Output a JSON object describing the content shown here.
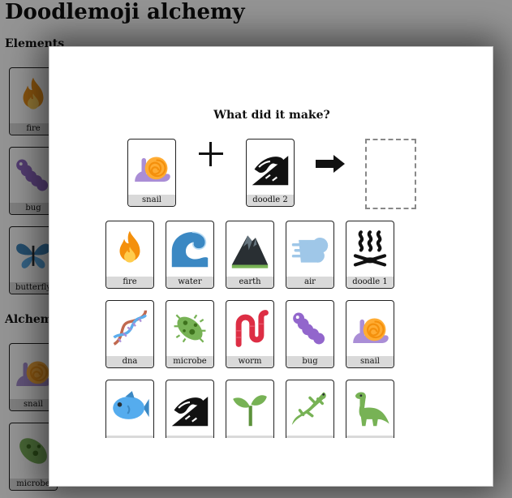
{
  "page_title": "Doodlemoji alchemy",
  "sections": {
    "elements_heading": "Elements",
    "alchemy_heading": "Alchemy"
  },
  "background_cards": [
    {
      "icon": "fire-icon",
      "label": "fire"
    },
    {
      "icon": "bug-icon",
      "label": "bug"
    },
    {
      "icon": "butterfly-icon",
      "label": "butterfly"
    },
    {
      "icon": "snail-icon",
      "label": "snail"
    },
    {
      "icon": "microbe-icon",
      "label": "microbe"
    }
  ],
  "modal": {
    "question": "What did it make?",
    "ingredient_a": {
      "icon": "snail-icon",
      "label": "snail"
    },
    "ingredient_b": {
      "icon": "doodle-2-icon",
      "label": "doodle 2"
    },
    "operator": "plus-icon",
    "result_arrow": "right-arrow-icon",
    "result_slot": "empty"
  },
  "choices": [
    {
      "icon": "fire-icon",
      "label": "fire"
    },
    {
      "icon": "water-icon",
      "label": "water"
    },
    {
      "icon": "earth-icon",
      "label": "earth"
    },
    {
      "icon": "air-icon",
      "label": "air"
    },
    {
      "icon": "doodle-1-icon",
      "label": "doodle 1"
    },
    {
      "icon": "dna-icon",
      "label": "dna"
    },
    {
      "icon": "microbe-icon",
      "label": "microbe"
    },
    {
      "icon": "worm-icon",
      "label": "worm"
    },
    {
      "icon": "bug-icon",
      "label": "bug"
    },
    {
      "icon": "snail-icon",
      "label": "snail"
    },
    {
      "icon": "fish-icon",
      "label": ""
    },
    {
      "icon": "doodle-2-icon",
      "label": ""
    },
    {
      "icon": "seedling-icon",
      "label": ""
    },
    {
      "icon": "lizard-icon",
      "label": ""
    },
    {
      "icon": "dinosaur-icon",
      "label": ""
    }
  ],
  "colors": {
    "fire": "#f4900c",
    "fire_inner": "#ffcc4d",
    "water": "#3b88c3",
    "earth": "#292f33",
    "earth_grass": "#77b255",
    "air": "#9fc7e8",
    "bug": "#9266cc",
    "snail_shell": "#ffac33",
    "snail_body": "#aa8ed6",
    "microbe": "#77b255",
    "worm": "#dd2e44",
    "fish": "#55acee",
    "plant": "#5c913b",
    "lizard": "#3e721d",
    "butterfly": "#3b88c3"
  }
}
